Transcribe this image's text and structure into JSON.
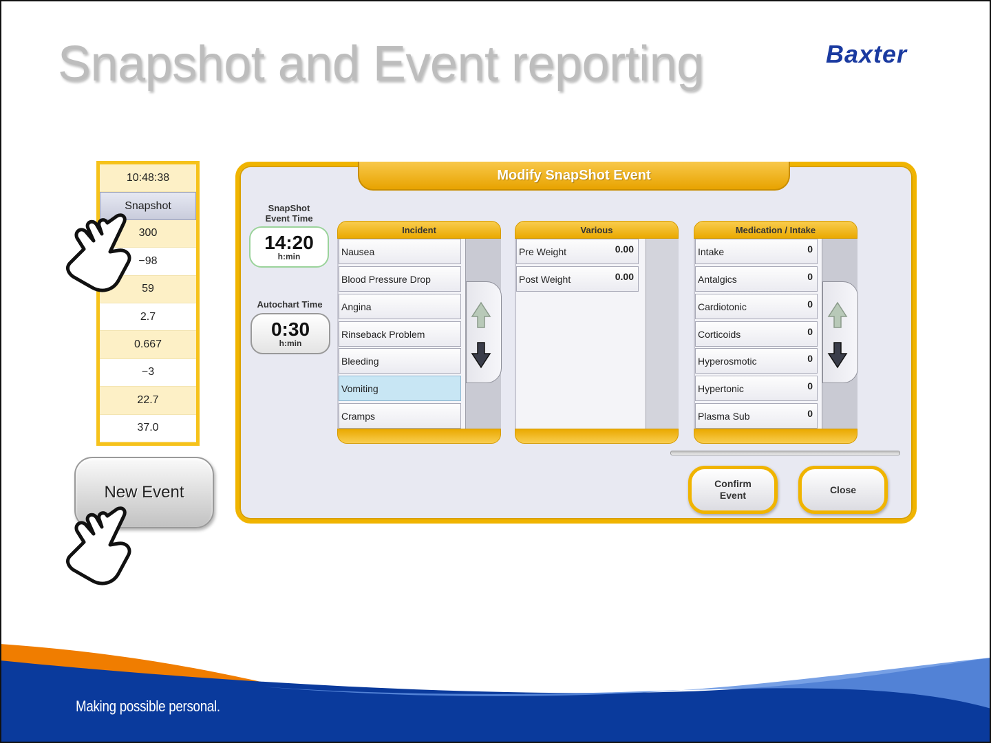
{
  "slide": {
    "title": "Snapshot and Event reporting",
    "brand": "Baxter",
    "tagline": "Making possible personal."
  },
  "value_column": {
    "rows": [
      "10:48:38",
      "Snapshot",
      "300",
      "−98",
      "59",
      "2.7",
      "0.667",
      "−3",
      "22.7",
      "37.0"
    ]
  },
  "new_event_button": {
    "label": "New Event"
  },
  "dialog": {
    "title": "Modify SnapShot Event",
    "snapshot_time": {
      "label_line1": "SnapShot",
      "label_line2": "Event Time",
      "value": "14:20",
      "unit": "h:min"
    },
    "autochart_time": {
      "label": "Autochart Time",
      "value": "0:30",
      "unit": "h:min"
    },
    "incident": {
      "title": "Incident",
      "items": [
        "Nausea",
        "Blood Pressure Drop",
        "Angina",
        "Rinseback Problem",
        "Bleeding",
        "Vomiting",
        "Cramps"
      ],
      "selected_index": 5
    },
    "various": {
      "title": "Various",
      "items": [
        {
          "label": "Pre Weight",
          "value": "0.00"
        },
        {
          "label": "Post Weight",
          "value": "0.00"
        }
      ]
    },
    "medication": {
      "title": "Medication / Intake",
      "items": [
        {
          "label": "Intake",
          "value": "0"
        },
        {
          "label": "Antalgics",
          "value": "0"
        },
        {
          "label": "Cardiotonic",
          "value": "0"
        },
        {
          "label": "Corticoids",
          "value": "0"
        },
        {
          "label": "Hyperosmotic",
          "value": "0"
        },
        {
          "label": "Hypertonic",
          "value": "0"
        },
        {
          "label": "Plasma Sub",
          "value": "0"
        }
      ]
    },
    "confirm_button": {
      "line1": "Confirm",
      "line2": "Event"
    },
    "close_button": {
      "label": "Close"
    }
  },
  "colors": {
    "accent_yellow": "#f0b400",
    "brand_blue": "#1a3aa0",
    "footer_blue": "#0a3a9c",
    "footer_orange": "#f07d00"
  }
}
